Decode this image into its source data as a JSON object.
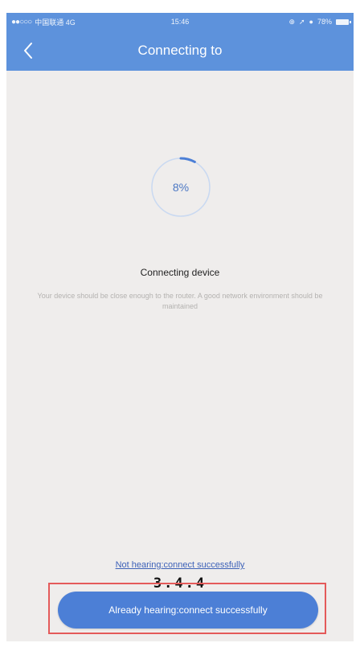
{
  "status_bar": {
    "carrier": "中国联通 4G",
    "time": "15:46",
    "battery": "78%"
  },
  "nav": {
    "title": "Connecting to",
    "back_icon": "chevron-left-icon"
  },
  "progress": {
    "percent_label": "8%",
    "value": 0.08
  },
  "content": {
    "title": "Connecting device",
    "description": "Your device should be close enough to the router. A good network environment should be maintained"
  },
  "actions": {
    "not_hearing_label": "Not hearing:connect successfully",
    "step_label": "3.4.4",
    "already_hearing_label": "Already hearing:connect successfully"
  },
  "colors": {
    "header": "#5d92dc",
    "button": "#4c7fd6",
    "ring_track": "#c9d9f1",
    "ring_progress": "#4c7fd6",
    "highlight": "#e45a5a"
  }
}
